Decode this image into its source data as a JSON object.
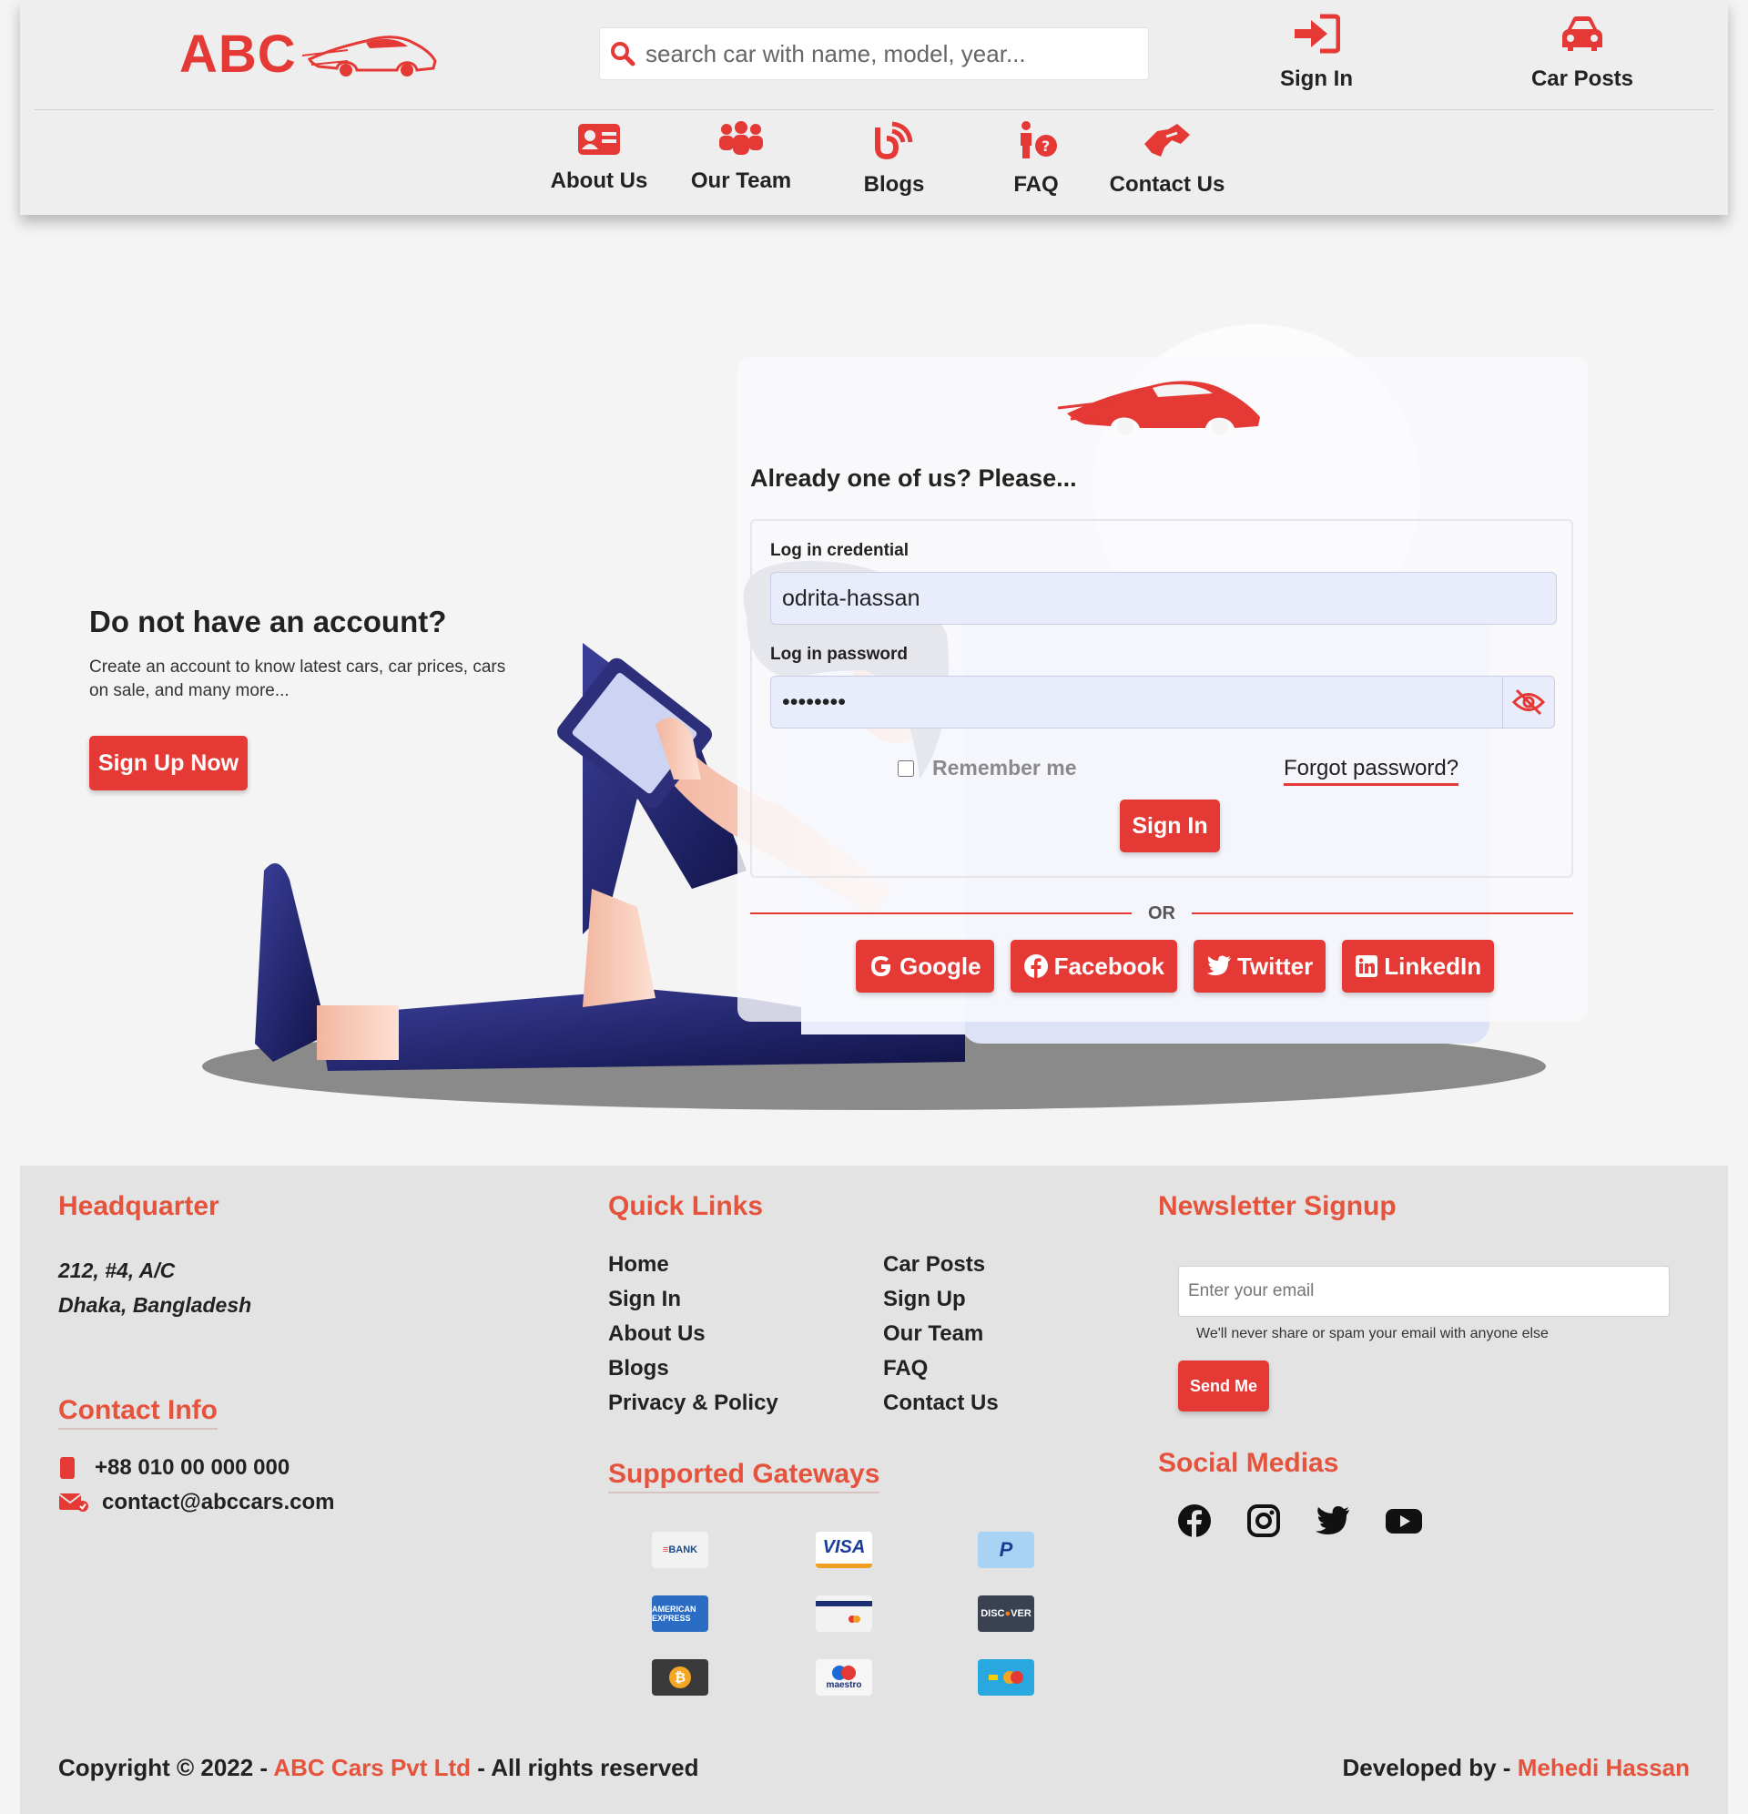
{
  "header": {
    "logo_text": "ABC",
    "search_placeholder": "search car with name, model, year...",
    "sign_in": "Sign In",
    "car_posts": "Car Posts",
    "nav": [
      "About Us",
      "Our Team",
      "Blogs",
      "FAQ",
      "Contact Us"
    ]
  },
  "hero": {
    "no_account_title": "Do not have an account?",
    "no_account_text": "Create an account to know latest cars, car prices, cars on sale, and many more...",
    "signup_button": "Sign Up Now"
  },
  "login": {
    "heading": "Already one of us? Please...",
    "credential_label": "Log in credential",
    "credential_value": "odrita-hassan",
    "password_label": "Log in password",
    "password_value": "••••••••",
    "remember_me": "Remember me",
    "forgot_password": "Forgot password?",
    "signin_button": "Sign In",
    "or_text": "OR",
    "social": [
      "Google",
      "Facebook",
      "Twitter",
      "LinkedIn"
    ]
  },
  "footer": {
    "headquarter_title": "Headquarter",
    "address_line1": "212, #4, A/C",
    "address_line2": "Dhaka, Bangladesh",
    "contact_title": "Contact Info",
    "phone": "+88 010 00 000 000",
    "email": "contact@abccars.com",
    "quick_links_title": "Quick Links",
    "quick_links_col1": [
      "Home",
      "Sign In",
      "About Us",
      "Blogs",
      "Privacy & Policy"
    ],
    "quick_links_col2": [
      "Car Posts",
      "Sign Up",
      "Our Team",
      "FAQ",
      "Contact Us"
    ],
    "gateways_title": "Supported Gateways",
    "gateways": [
      "BANK TRANSFER",
      "VISA",
      "PayPal",
      "AMERICAN EXPRESS",
      "Credit Card",
      "DISCOVER",
      "Bitcoin",
      "maestro",
      "Mastercard"
    ],
    "newsletter_title": "Newsletter Signup",
    "newsletter_placeholder": "Enter your email",
    "newsletter_note": "We'll never share or spam your email with anyone else",
    "send_button": "Send Me",
    "social_title": "Social Medias",
    "social_icons": [
      "facebook-icon",
      "instagram-icon",
      "twitter-icon",
      "youtube-icon"
    ],
    "copyright_prefix": "Copyright © 2022 -",
    "company": "ABC Cars Pvt Ltd",
    "copyright_suffix": "- All rights reserved",
    "developed_by": "Developed by -",
    "developer": "Mehedi Hassan"
  },
  "colors": {
    "accent": "#e53935",
    "footer_heading": "#e5533d",
    "navy": "#1c1f5e"
  }
}
